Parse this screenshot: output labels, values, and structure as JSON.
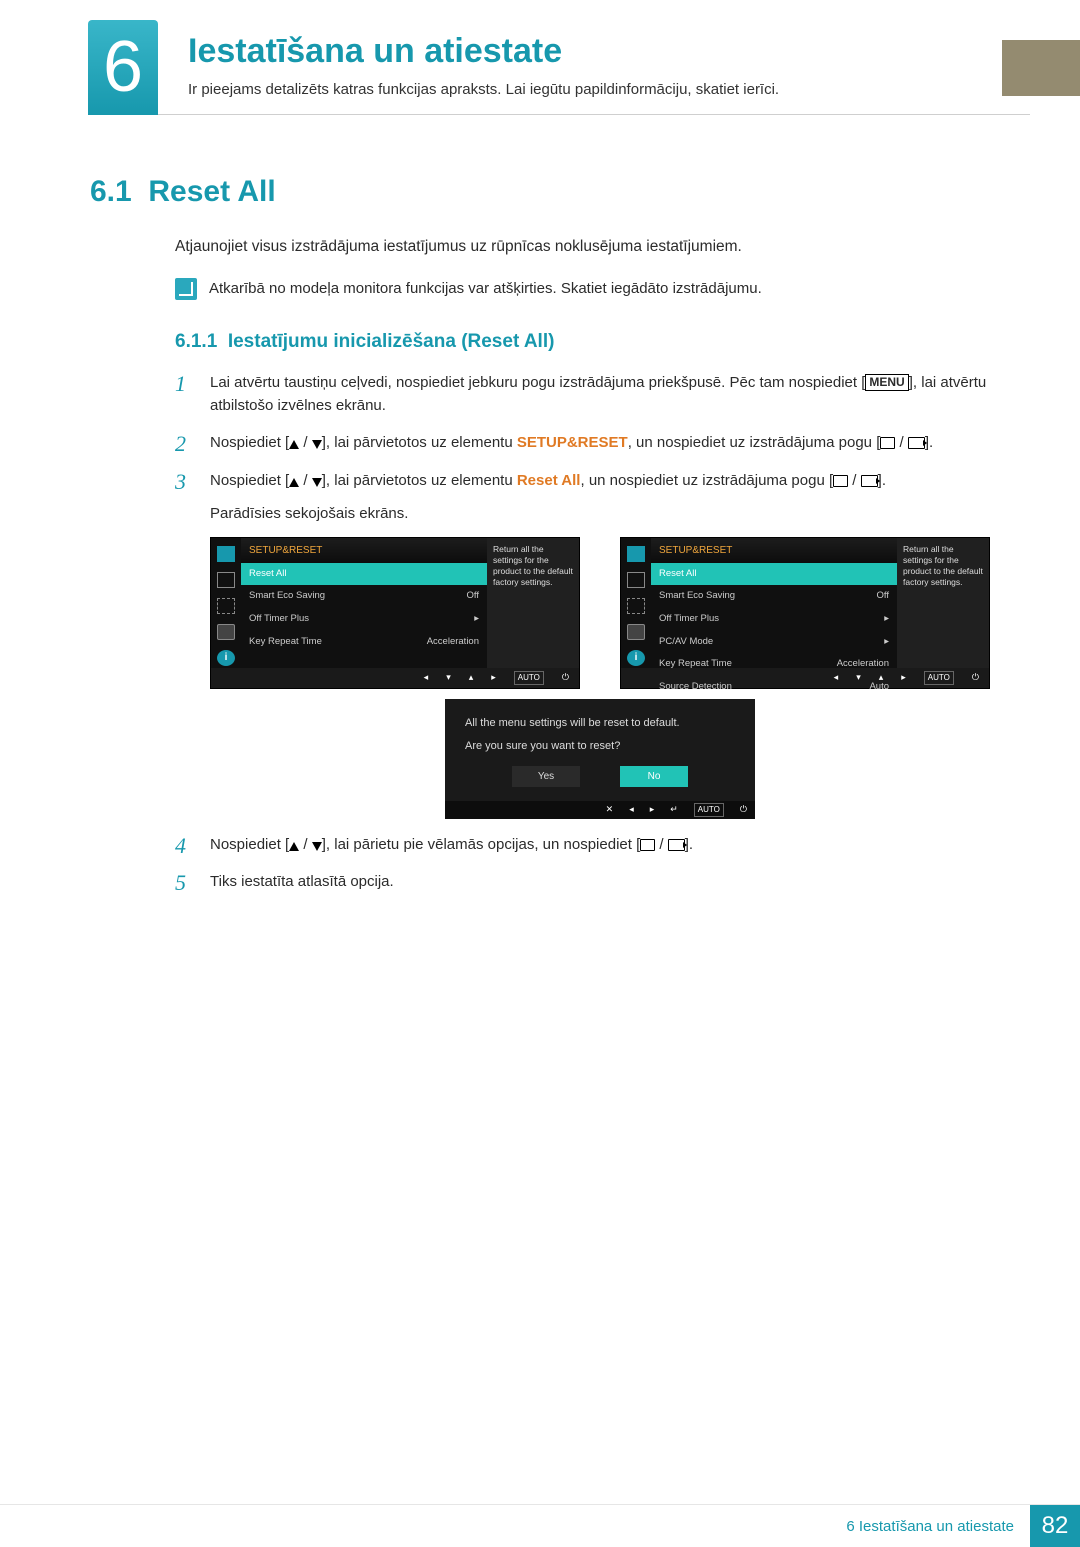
{
  "chapter": {
    "number": "6",
    "title": "Iestatīšana un atiestate",
    "subtitle": "Ir pieejams detalizēts katras funkcijas apraksts. Lai iegūtu papildinformāciju, skatiet ierīci."
  },
  "section": {
    "number": "6.1",
    "title": "Reset All",
    "intro": "Atjaunojiet visus izstrādājuma iestatījumus uz rūpnīcas noklusējuma iestatījumiem.",
    "note": "Atkarībā no modeļa monitora funkcijas var atšķirties. Skatiet iegādāto izstrādājumu."
  },
  "subsection": {
    "number": "6.1.1",
    "title": "Iestatījumu inicializēšana (Reset All)"
  },
  "steps": {
    "s1_a": "Lai atvērtu taustiņu ceļvedi, nospiediet jebkuru pogu izstrādājuma priekšpusē. Pēc tam nospiediet [",
    "s1_menu": "MENU",
    "s1_b": "], lai atvērtu atbilstošo izvēlnes ekrānu.",
    "s2_a": "Nospiediet [",
    "s2_b": "], lai pārvietotos uz elementu ",
    "s2_hl": "SETUP&RESET",
    "s2_c": ", un nospiediet uz izstrādājuma pogu [",
    "s2_d": "].",
    "s3_a": "Nospiediet [",
    "s3_b": "], lai pārvietotos uz elementu ",
    "s3_hl": "Reset All",
    "s3_c": ", un nospiediet uz izstrādājuma pogu [",
    "s3_d": "].",
    "s3_follow": "Parādīsies sekojošais ekrāns.",
    "s4_a": "Nospiediet [",
    "s4_b": "], lai pārietu pie vēlamās opcijas, un nospiediet [",
    "s4_c": "].",
    "s5": "Tiks iestatīta atlasītā opcija."
  },
  "osd": {
    "header": "SETUP&RESET",
    "desc": "Return all the settings for the product to the default factory settings.",
    "auto": "AUTO",
    "left": [
      {
        "label": "Reset All",
        "value": "",
        "selected": true
      },
      {
        "label": "Smart Eco Saving",
        "value": "Off"
      },
      {
        "label": "Off Timer Plus",
        "value": "▸"
      },
      {
        "label": "Key Repeat Time",
        "value": "Acceleration"
      }
    ],
    "right": [
      {
        "label": "Reset All",
        "value": "",
        "selected": true
      },
      {
        "label": "Smart Eco Saving",
        "value": "Off"
      },
      {
        "label": "Off Timer Plus",
        "value": "▸"
      },
      {
        "label": "PC/AV Mode",
        "value": "▸"
      },
      {
        "label": "Key Repeat Time",
        "value": "Acceleration"
      },
      {
        "label": "Source Detection",
        "value": "Auto"
      }
    ]
  },
  "confirm": {
    "line1": "All the menu settings will be reset to default.",
    "line2": "Are you sure you want to reset?",
    "yes": "Yes",
    "no": "No",
    "auto": "AUTO"
  },
  "footer": {
    "text": "6 Iestatīšana un atiestate",
    "page": "82"
  }
}
